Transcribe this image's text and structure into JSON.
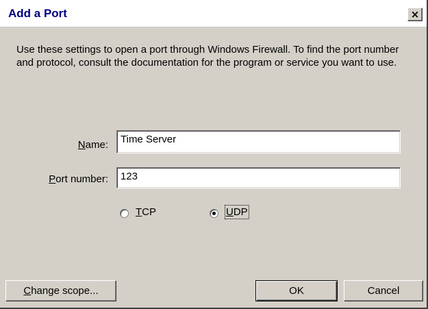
{
  "window": {
    "title": "Add a Port",
    "close_glyph": "×"
  },
  "description": "Use these settings to open a port through Windows Firewall. To find the port number and protocol, consult the documentation for the program or service you want to use.",
  "form": {
    "name": {
      "label_prefix": "",
      "label_accel": "N",
      "label_rest": "ame:",
      "value": "Time Server"
    },
    "port": {
      "label_prefix": "",
      "label_accel": "P",
      "label_rest": "ort number:",
      "value": "123"
    }
  },
  "protocol": {
    "tcp": {
      "accel": "T",
      "rest": "CP",
      "checked": false
    },
    "udp": {
      "accel": "U",
      "rest": "DP",
      "checked": true
    }
  },
  "buttons": {
    "change_scope": {
      "accel": "C",
      "rest": "hange scope..."
    },
    "ok": "OK",
    "cancel": "Cancel"
  }
}
